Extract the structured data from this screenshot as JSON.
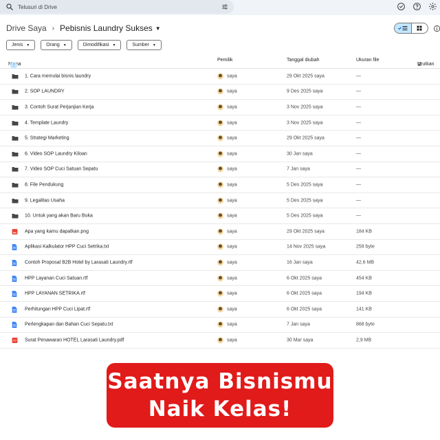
{
  "search": {
    "placeholder": "Telusuri di Drive"
  },
  "breadcrumb": {
    "root": "Drive Saya",
    "current": "Pebisnis Laundry Sukses"
  },
  "filters": [
    "Jenis",
    "Orang",
    "Dimodifikasi",
    "Sumber"
  ],
  "columns": {
    "name": "Nama",
    "owner": "Pemilik",
    "modified": "Tanggal diubah",
    "size": "Ukuran file",
    "sort": "Urutkan"
  },
  "files": [
    {
      "type": "folder",
      "name": "1. Cara memulai bisnis laundry",
      "owner": "saya",
      "modified": "29 Okt 2025 saya",
      "size": "—"
    },
    {
      "type": "folder",
      "name": "2. SOP LAUNDRY",
      "owner": "saya",
      "modified": "9 Des 2025 saya",
      "size": "—"
    },
    {
      "type": "folder",
      "name": "3. Contoh Surat Perjanjian Kerja",
      "owner": "saya",
      "modified": "3 Nov 2025 saya",
      "size": "—"
    },
    {
      "type": "folder",
      "name": "4. Template Laundry",
      "owner": "saya",
      "modified": "3 Nov 2025 saya",
      "size": "—"
    },
    {
      "type": "folder",
      "name": "5. Strategi Marketing",
      "owner": "saya",
      "modified": "29 Okt 2025 saya",
      "size": "—"
    },
    {
      "type": "folder",
      "name": "6. Video SOP Laundry Kiloan",
      "owner": "saya",
      "modified": "30 Jan saya",
      "size": "—"
    },
    {
      "type": "folder",
      "name": "7. Video SOP Cuci Satuan Sepatu",
      "owner": "saya",
      "modified": "7 Jan saya",
      "size": "—"
    },
    {
      "type": "folder",
      "name": "8. File Pendukung",
      "owner": "saya",
      "modified": "5 Des 2025 saya",
      "size": "—"
    },
    {
      "type": "folder",
      "name": "9. Legalitas Usaha",
      "owner": "saya",
      "modified": "5 Des 2025 saya",
      "size": "—"
    },
    {
      "type": "folder",
      "name": "10. Untuk yang akan Baru Buka",
      "owner": "saya",
      "modified": "5 Des 2025 saya",
      "size": "—"
    },
    {
      "type": "image",
      "name": "Apa yang kamu dapatkan.png",
      "owner": "saya",
      "modified": "29 Okt 2025 saya",
      "size": "184 KB"
    },
    {
      "type": "doc",
      "name": "Aplikasi Kalkulator HPP Cuci Setrika.txt",
      "owner": "saya",
      "modified": "14 Nov 2025 saya",
      "size": "259 byte"
    },
    {
      "type": "doc",
      "name": "Contoh Proposal B2B Hotel by Larasati Laundry.rtf",
      "owner": "saya",
      "modified": "16 Jan saya",
      "size": "42,6 MB"
    },
    {
      "type": "doc",
      "name": "HPP Layanan Cuci Satuan.rtf",
      "owner": "saya",
      "modified": "6 Okt 2025 saya",
      "size": "454 KB"
    },
    {
      "type": "doc",
      "name": "HPP LAYANAN SETRIKA.rtf",
      "owner": "saya",
      "modified": "6 Okt 2025 saya",
      "size": "194 KB"
    },
    {
      "type": "doc",
      "name": "Perhitungan HPP Cuci Lipat.rtf",
      "owner": "saya",
      "modified": "6 Okt 2025 saya",
      "size": "141 KB"
    },
    {
      "type": "doc",
      "name": "Perlengkapan dan Bahan Cuci Sepatu.txt",
      "owner": "saya",
      "modified": "7 Jan saya",
      "size": "868 byte"
    },
    {
      "type": "pdf",
      "name": "Surat Penawaran HOTEL Larasati Laundry.pdf",
      "owner": "saya",
      "modified": "30 Mar saya",
      "size": "2,9 MB"
    }
  ],
  "promo": {
    "line1": "Saatnya Bisnismu",
    "line2": "Naik Kelas!"
  },
  "colors": {
    "accent": "#0b57d0",
    "promo_bg": "#e11a1a",
    "folder": "#444746",
    "doc": "#4285f4",
    "image": "#ea4335",
    "pdf": "#ea4335"
  }
}
